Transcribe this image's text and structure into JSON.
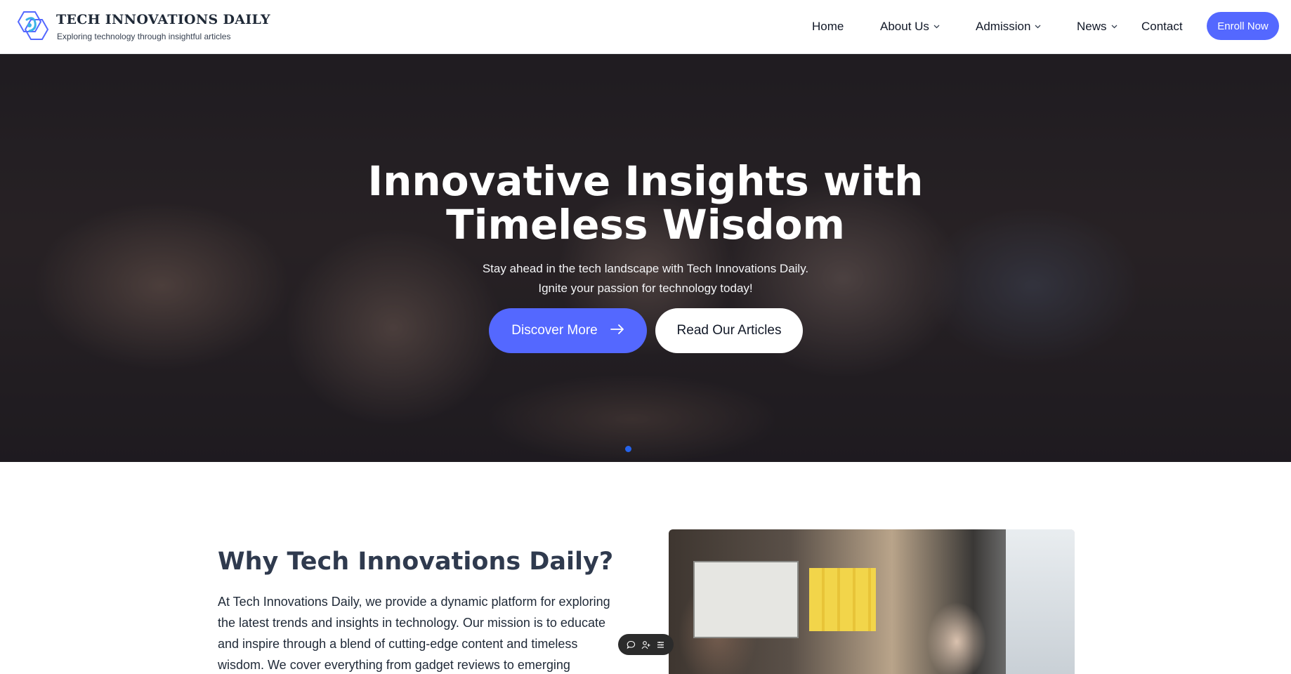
{
  "brand": {
    "title": "TECH INNOVATIONS DAILY",
    "subtitle": "Exploring technology through insightful articles"
  },
  "nav": {
    "items": [
      {
        "label": "Home",
        "has_dropdown": false
      },
      {
        "label": "About Us",
        "has_dropdown": true
      },
      {
        "label": "Admission",
        "has_dropdown": true
      },
      {
        "label": "News",
        "has_dropdown": true
      },
      {
        "label": "Contact",
        "has_dropdown": false
      }
    ],
    "cta": "Enroll Now"
  },
  "hero": {
    "title_line1": "Innovative Insights with",
    "title_line2": "Timeless Wisdom",
    "subtitle_line1": "Stay ahead in the tech landscape with Tech Innovations Daily.",
    "subtitle_line2": "Ignite your passion for technology today!",
    "primary_button": "Discover More",
    "secondary_button": "Read Our Articles"
  },
  "why": {
    "title": "Why Tech Innovations Daily?",
    "text": "At Tech Innovations Daily, we provide a dynamic platform for exploring the latest trends and insights in technology. Our mission is to educate and inspire through a blend of cutting-edge content and timeless wisdom. We cover everything from gadget reviews to emerging"
  },
  "colors": {
    "accent": "#5468ff",
    "heading": "#2f3a4e",
    "text": "#1f2937",
    "slider_dot": "#2563eb"
  },
  "icons": {
    "logo": "hexagon-logo-icon",
    "nav_dropdown": "chevron-down-icon",
    "discover_arrow": "arrow-right-icon",
    "chat": "chat-bubble-icon",
    "user": "add-user-icon",
    "menu": "menu-lines-icon"
  }
}
